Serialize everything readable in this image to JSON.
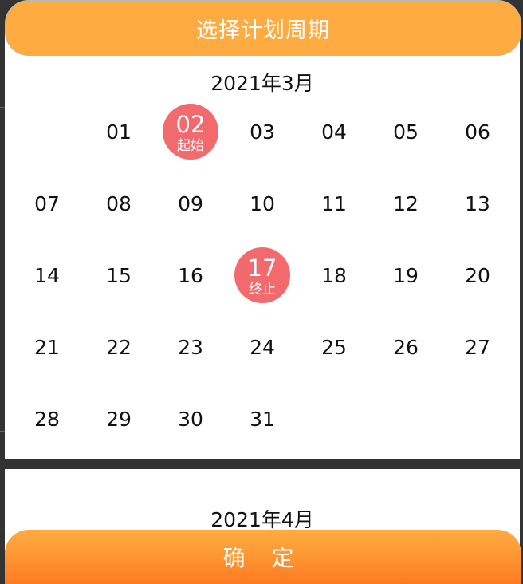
{
  "header": {
    "title": "选择计划周期"
  },
  "months": [
    {
      "title": "2021年3月",
      "leading_blanks": 1,
      "days": [
        "01",
        "02",
        "03",
        "04",
        "05",
        "06",
        "07",
        "08",
        "09",
        "10",
        "11",
        "12",
        "13",
        "14",
        "15",
        "16",
        "17",
        "18",
        "19",
        "20",
        "21",
        "22",
        "23",
        "24",
        "25",
        "26",
        "27",
        "28",
        "29",
        "30",
        "31"
      ],
      "range": {
        "start": {
          "day": "02",
          "label": "起始"
        },
        "end": {
          "day": "17",
          "label": "终止"
        }
      }
    },
    {
      "title": "2021年4月"
    }
  ],
  "confirm": {
    "label": "确 定"
  },
  "colors": {
    "accent": "#FEAB42",
    "selected": "#F26A6D",
    "background": "#333333"
  }
}
